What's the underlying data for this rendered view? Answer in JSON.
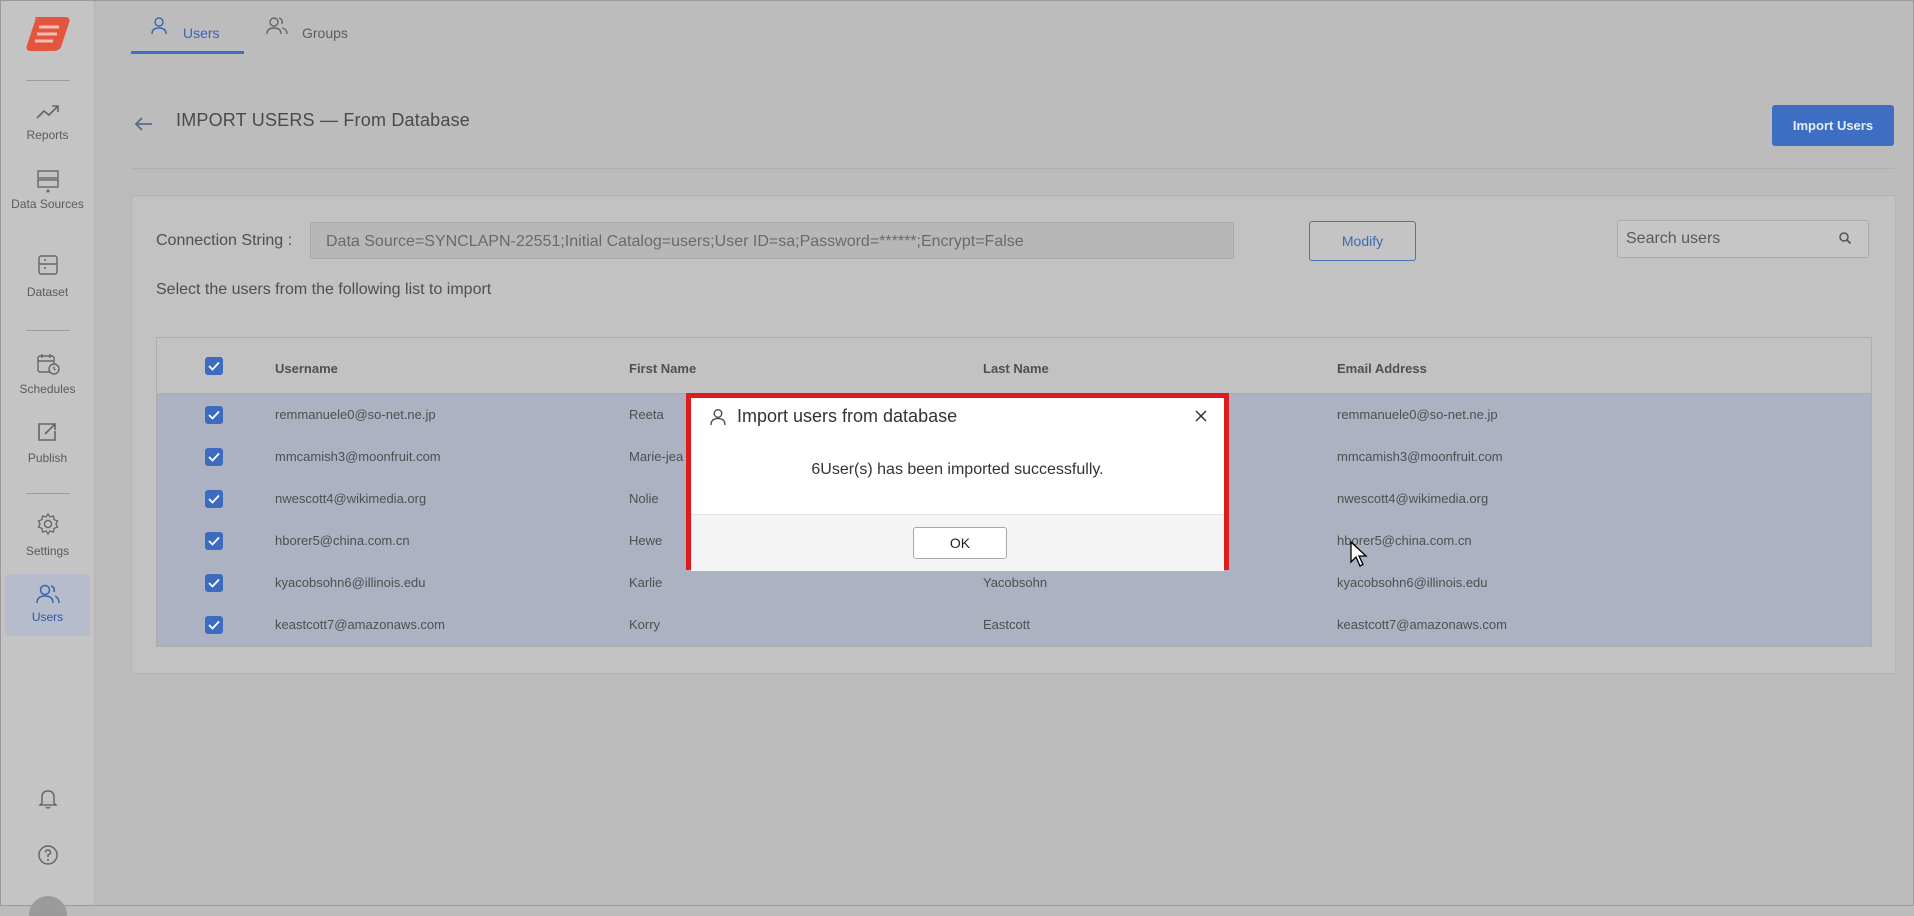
{
  "sidebar": {
    "items": [
      {
        "label": "Reports",
        "icon": "trending-up-icon"
      },
      {
        "label": "Data Sources",
        "icon": "server-icon"
      },
      {
        "label": "Dataset",
        "icon": "dataset-icon"
      },
      {
        "label": "Schedules",
        "icon": "calendar-clock-icon"
      },
      {
        "label": "Publish",
        "icon": "publish-icon"
      },
      {
        "label": "Settings",
        "icon": "gear-icon"
      },
      {
        "label": "Users",
        "icon": "users-icon",
        "active": true
      }
    ]
  },
  "tabs": [
    {
      "label": "Users",
      "active": true
    },
    {
      "label": "Groups",
      "active": false
    }
  ],
  "header": {
    "title": "IMPORT USERS — From Database",
    "import_button": "Import Users"
  },
  "connection": {
    "label": "Connection String :",
    "value": "Data Source=SYNCLAPN-22551;Initial Catalog=users;User ID=sa;Password=******;Encrypt=False",
    "modify_button": "Modify"
  },
  "search": {
    "placeholder": "Search users"
  },
  "instruction": "Select the users from the following list to import",
  "table": {
    "columns": [
      "Username",
      "First Name",
      "Last Name",
      "Email Address"
    ],
    "rows": [
      {
        "username": "remmanuele0@so-net.ne.jp",
        "first": "Reeta",
        "last": "",
        "email": "remmanuele0@so-net.ne.jp"
      },
      {
        "username": "mmcamish3@moonfruit.com",
        "first": "Marie-jea",
        "last": "",
        "email": "mmcamish3@moonfruit.com"
      },
      {
        "username": "nwescott4@wikimedia.org",
        "first": "Nolie",
        "last": "",
        "email": "nwescott4@wikimedia.org"
      },
      {
        "username": "hborer5@china.com.cn",
        "first": "Hewe",
        "last": "",
        "email": "hborer5@china.com.cn"
      },
      {
        "username": "kyacobsohn6@illinois.edu",
        "first": "Karlie",
        "last": "Yacobsohn",
        "email": "kyacobsohn6@illinois.edu"
      },
      {
        "username": "keastcott7@amazonaws.com",
        "first": "Korry",
        "last": "Eastcott",
        "email": "keastcott7@amazonaws.com"
      }
    ]
  },
  "dialog": {
    "title": "Import users from database",
    "message": "6User(s) has been imported successfully.",
    "ok_button": "OK"
  },
  "colors": {
    "accent": "#3d6ec2",
    "highlight": "#e01b1b",
    "logo": "#e4553f"
  }
}
